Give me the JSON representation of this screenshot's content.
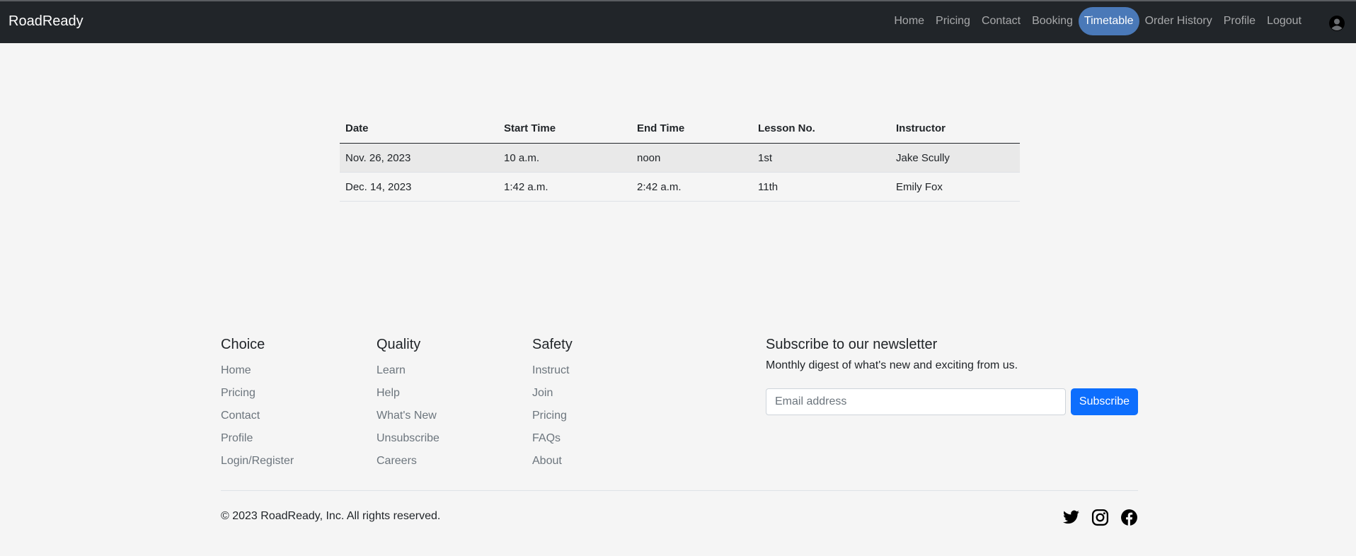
{
  "navbar": {
    "brand": "RoadReady",
    "links": [
      "Home",
      "Pricing",
      "Contact",
      "Booking",
      "Timetable",
      "Order History",
      "Profile",
      "Logout"
    ],
    "active": "Timetable"
  },
  "table": {
    "headers": [
      "Date",
      "Start Time",
      "End Time",
      "Lesson No.",
      "Instructor"
    ],
    "rows": [
      [
        "Nov. 26, 2023",
        "10 a.m.",
        "noon",
        "1st",
        "Jake Scully"
      ],
      [
        "Dec. 14, 2023",
        "1:42 a.m.",
        "2:42 a.m.",
        "11th",
        "Emily Fox"
      ]
    ]
  },
  "footer": {
    "columns": [
      {
        "title": "Choice",
        "links": [
          "Home",
          "Pricing",
          "Contact",
          "Profile",
          "Login/Register"
        ]
      },
      {
        "title": "Quality",
        "links": [
          "Learn",
          "Help",
          "What's New",
          "Unsubscribe",
          "Careers"
        ]
      },
      {
        "title": "Safety",
        "links": [
          "Instruct",
          "Join",
          "Pricing",
          "FAQs",
          "About"
        ]
      }
    ],
    "newsletter": {
      "title": "Subscribe to our newsletter",
      "subtitle": "Monthly digest of what's new and exciting from us.",
      "placeholder": "Email address",
      "button": "Subscribe"
    },
    "copyright": "© 2023 RoadReady, Inc. All rights reserved.",
    "social_icons": [
      "twitter-icon",
      "instagram-icon",
      "facebook-icon"
    ]
  },
  "colors": {
    "navbar_bg": "#212529",
    "active_pill": "#4a79b8",
    "primary": "#0d6efd",
    "page_bg": "#f5f5f5"
  }
}
